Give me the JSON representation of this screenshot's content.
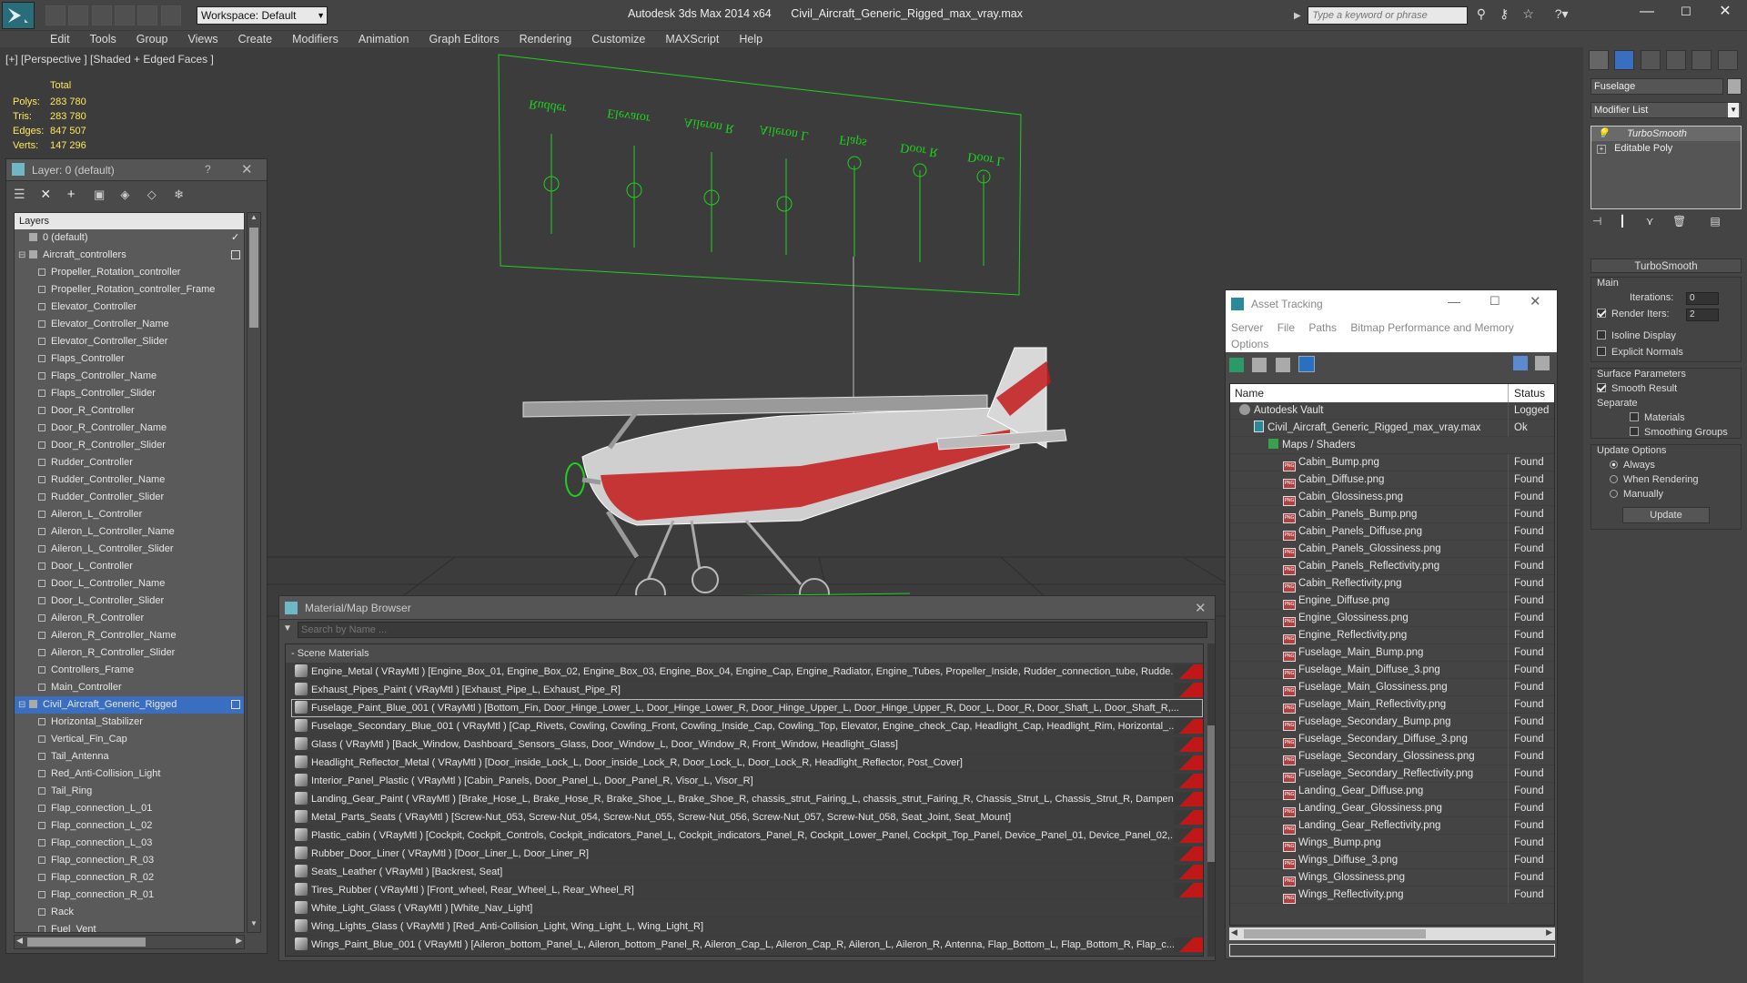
{
  "titlebar": {
    "workspace": "Workspace: Default",
    "title": "Autodesk 3ds Max  2014 x64",
    "filename": "Civil_Aircraft_Generic_Rigged_max_vray.max",
    "search_placeholder": "Type a keyword or phrase"
  },
  "menu": [
    "Edit",
    "Tools",
    "Group",
    "Views",
    "Create",
    "Modifiers",
    "Animation",
    "Graph Editors",
    "Rendering",
    "Customize",
    "MAXScript",
    "Help"
  ],
  "viewport": {
    "label": "[+] [Perspective ] [Shaded + Edged Faces ]",
    "stats": {
      "header": "Total",
      "rows": [
        {
          "k": "Polys:",
          "v": "283 780"
        },
        {
          "k": "Tris:",
          "v": "283 780"
        },
        {
          "k": "Edges:",
          "v": "847 507"
        },
        {
          "k": "Verts:",
          "v": "147 296"
        }
      ]
    },
    "control_labels": [
      "Rudder",
      "Elevator",
      "Aileron R",
      "Aileron L",
      "Flaps",
      "Door R",
      "Door L"
    ],
    "colors": {
      "wire": "#1fd01f",
      "red": "#c41a1a"
    }
  },
  "layer_panel": {
    "title": "Layer: 0 (default)",
    "help": "?",
    "header": "Layers",
    "rows": [
      {
        "label": "0 (default)",
        "kind": "layer",
        "indent": 0,
        "sel": false
      },
      {
        "label": "Aircraft_controllers",
        "kind": "layer",
        "indent": 0,
        "sel": false
      },
      {
        "label": "Propeller_Rotation_controller",
        "kind": "obj",
        "indent": 1,
        "sel": false
      },
      {
        "label": "Propeller_Rotation_controller_Frame",
        "kind": "obj",
        "indent": 1,
        "sel": false
      },
      {
        "label": "Elevator_Controller",
        "kind": "obj",
        "indent": 1,
        "sel": false
      },
      {
        "label": "Elevator_Controller_Name",
        "kind": "obj",
        "indent": 1,
        "sel": false
      },
      {
        "label": "Elevator_Controller_Slider",
        "kind": "obj",
        "indent": 1,
        "sel": false
      },
      {
        "label": "Flaps_Controller",
        "kind": "obj",
        "indent": 1,
        "sel": false
      },
      {
        "label": "Flaps_Controller_Name",
        "kind": "obj",
        "indent": 1,
        "sel": false
      },
      {
        "label": "Flaps_Controller_Slider",
        "kind": "obj",
        "indent": 1,
        "sel": false
      },
      {
        "label": "Door_R_Controller",
        "kind": "obj",
        "indent": 1,
        "sel": false
      },
      {
        "label": "Door_R_Controller_Name",
        "kind": "obj",
        "indent": 1,
        "sel": false
      },
      {
        "label": "Door_R_Controller_Slider",
        "kind": "obj",
        "indent": 1,
        "sel": false
      },
      {
        "label": "Rudder_Controller",
        "kind": "obj",
        "indent": 1,
        "sel": false
      },
      {
        "label": "Rudder_Controller_Name",
        "kind": "obj",
        "indent": 1,
        "sel": false
      },
      {
        "label": "Rudder_Controller_Slider",
        "kind": "obj",
        "indent": 1,
        "sel": false
      },
      {
        "label": "Aileron_L_Controller",
        "kind": "obj",
        "indent": 1,
        "sel": false
      },
      {
        "label": "Aileron_L_Controller_Name",
        "kind": "obj",
        "indent": 1,
        "sel": false
      },
      {
        "label": "Aileron_L_Controller_Slider",
        "kind": "obj",
        "indent": 1,
        "sel": false
      },
      {
        "label": "Door_L_Controller",
        "kind": "obj",
        "indent": 1,
        "sel": false
      },
      {
        "label": "Door_L_Controller_Name",
        "kind": "obj",
        "indent": 1,
        "sel": false
      },
      {
        "label": "Door_L_Controller_Slider",
        "kind": "obj",
        "indent": 1,
        "sel": false
      },
      {
        "label": "Aileron_R_Controller",
        "kind": "obj",
        "indent": 1,
        "sel": false
      },
      {
        "label": "Aileron_R_Controller_Name",
        "kind": "obj",
        "indent": 1,
        "sel": false
      },
      {
        "label": "Aileron_R_Controller_Slider",
        "kind": "obj",
        "indent": 1,
        "sel": false
      },
      {
        "label": "Controllers_Frame",
        "kind": "obj",
        "indent": 1,
        "sel": false
      },
      {
        "label": "Main_Controller",
        "kind": "obj",
        "indent": 1,
        "sel": false
      },
      {
        "label": "Civil_Aircraft_Generic_Rigged",
        "kind": "layer",
        "indent": 0,
        "sel": true
      },
      {
        "label": "Horizontal_Stabilizer",
        "kind": "obj",
        "indent": 1,
        "sel": false
      },
      {
        "label": "Vertical_Fin_Cap",
        "kind": "obj",
        "indent": 1,
        "sel": false
      },
      {
        "label": "Tail_Antenna",
        "kind": "obj",
        "indent": 1,
        "sel": false
      },
      {
        "label": "Red_Anti-Collision_Light",
        "kind": "obj",
        "indent": 1,
        "sel": false
      },
      {
        "label": "Tail_Ring",
        "kind": "obj",
        "indent": 1,
        "sel": false
      },
      {
        "label": "Flap_connection_L_01",
        "kind": "obj",
        "indent": 1,
        "sel": false
      },
      {
        "label": "Flap_connection_L_02",
        "kind": "obj",
        "indent": 1,
        "sel": false
      },
      {
        "label": "Flap_connection_L_03",
        "kind": "obj",
        "indent": 1,
        "sel": false
      },
      {
        "label": "Flap_connection_R_03",
        "kind": "obj",
        "indent": 1,
        "sel": false
      },
      {
        "label": "Flap_connection_R_02",
        "kind": "obj",
        "indent": 1,
        "sel": false
      },
      {
        "label": "Flap_connection_R_01",
        "kind": "obj",
        "indent": 1,
        "sel": false
      },
      {
        "label": "Rack",
        "kind": "obj",
        "indent": 1,
        "sel": false
      },
      {
        "label": "Fuel_Vent",
        "kind": "obj",
        "indent": 1,
        "sel": false
      }
    ]
  },
  "material_browser": {
    "title": "Material/Map Browser",
    "search_placeholder": "Search by Name ...",
    "group": "- Scene Materials",
    "rows": [
      {
        "text": "Engine_Metal  ( VRayMtl ) [Engine_Box_01, Engine_Box_02, Engine_Box_03, Engine_Box_04, Engine_Cap, Engine_Radiator, Engine_Tubes, Propeller_Inside, Rudder_connection_tube, Rudde...",
        "red": true,
        "sel": false
      },
      {
        "text": "Exhaust_Pipes_Paint  ( VRayMtl ) [Exhaust_Pipe_L, Exhaust_Pipe_R]",
        "red": true,
        "sel": false
      },
      {
        "text": "Fuselage_Paint_Blue_001 ( VRayMtl ) [Bottom_Fin, Door_Hinge_Lower_L, Door_Hinge_Lower_R, Door_Hinge_Upper_L, Door_Hinge_Upper_R, Door_L, Door_R, Door_Shaft_L, Door_Shaft_R,...",
        "red": false,
        "sel": true
      },
      {
        "text": "Fuselage_Secondary_Blue_001 ( VRayMtl ) [Cap_Rivets, Cowling, Cowling_Front, Cowling_Inside_Cap, Cowling_Top, Elevator, Engine_check_Cap, Headlight_Cap, Headlight_Rim, Horizontal_...",
        "red": true,
        "sel": false
      },
      {
        "text": "Glass ( VRayMtl ) [Back_Window, Dashboard_Sensors_Glass, Door_Window_L, Door_Window_R, Front_Window, Headlight_Glass]",
        "red": true,
        "sel": false
      },
      {
        "text": "Headlight_Reflector_Metal ( VRayMtl ) [Door_inside_Lock_L, Door_inside_Lock_R, Door_Lock_L, Door_Lock_R, Headlight_Reflector, Post_Cover]",
        "red": true,
        "sel": false
      },
      {
        "text": "Interior_Panel_Plastic  ( VRayMtl ) [Cabin_Panels, Door_Panel_L, Door_Panel_R, Visor_L, Visor_R]",
        "red": true,
        "sel": false
      },
      {
        "text": "Landing_Gear_Paint ( VRayMtl ) [Brake_Hose_L, Brake_Hose_R, Brake_Shoe_L, Brake_Shoe_R, chassis_strut_Fairing_L, chassis_strut_Fairing_R, Chassis_Strut_L, Chassis_Strut_R, Dampene...",
        "red": true,
        "sel": false
      },
      {
        "text": "Metal_Parts_Seats  ( VRayMtl ) [Screw-Nut_053, Screw-Nut_054, Screw-Nut_055, Screw-Nut_056, Screw-Nut_057, Screw-Nut_058, Seat_Joint, Seat_Mount]",
        "red": true,
        "sel": false
      },
      {
        "text": "Plastic_cabin ( VRayMtl ) [Cockpit, Cockpit_Controls, Cockpit_indicators_Panel_L, Cockpit_indicators_Panel_R, Cockpit_Lower_Panel, Cockpit_Top_Panel, Device_Panel_01, Device_Panel_02,...",
        "red": true,
        "sel": false
      },
      {
        "text": "Rubber_Door_Liner  ( VRayMtl ) [Door_Liner_L, Door_Liner_R]",
        "red": true,
        "sel": false
      },
      {
        "text": "Seats_Leather  ( VRayMtl ) [Backrest, Seat]",
        "red": true,
        "sel": false
      },
      {
        "text": "Tires_Rubber  ( VRayMtl ) [Front_wheel, Rear_Wheel_L, Rear_Wheel_R]",
        "red": true,
        "sel": false
      },
      {
        "text": "White_Light_Glass  ( VRayMtl ) [White_Nav_Light]",
        "red": false,
        "sel": false
      },
      {
        "text": "Wing_Lights_Glass ( VRayMtl ) [Red_Anti-Collision_Light, Wing_Light_L, Wing_Light_R]",
        "red": false,
        "sel": false
      },
      {
        "text": "Wings_Paint_Blue_001  ( VRayMtl ) [Aileron_bottom_Panel_L, Aileron_bottom_Panel_R, Aileron_Cap_L, Aileron_Cap_R, Aileron_L, Aileron_R, Antenna, Flap_Bottom_L, Flap_Bottom_R, Flap_c...",
        "red": true,
        "sel": false
      }
    ]
  },
  "asset_tracking": {
    "title": "Asset Tracking",
    "menu": [
      "Server",
      "File",
      "Paths",
      "Bitmap Performance and Memory"
    ],
    "menu2": "Options",
    "col_name": "Name",
    "col_status": "Status",
    "rows": [
      {
        "name": "Autodesk Vault",
        "status": "Logged",
        "indent": 1,
        "kind": "vault"
      },
      {
        "name": "Civil_Aircraft_Generic_Rigged_max_vray.max",
        "status": "Ok",
        "indent": 2,
        "kind": "max"
      },
      {
        "name": "Maps / Shaders",
        "status": "",
        "indent": 3,
        "kind": "folder"
      },
      {
        "name": "Cabin_Bump.png",
        "status": "Found",
        "indent": 4,
        "kind": "png"
      },
      {
        "name": "Cabin_Diffuse.png",
        "status": "Found",
        "indent": 4,
        "kind": "png"
      },
      {
        "name": "Cabin_Glossiness.png",
        "status": "Found",
        "indent": 4,
        "kind": "png"
      },
      {
        "name": "Cabin_Panels_Bump.png",
        "status": "Found",
        "indent": 4,
        "kind": "png"
      },
      {
        "name": "Cabin_Panels_Diffuse.png",
        "status": "Found",
        "indent": 4,
        "kind": "png"
      },
      {
        "name": "Cabin_Panels_Glossiness.png",
        "status": "Found",
        "indent": 4,
        "kind": "png"
      },
      {
        "name": "Cabin_Panels_Reflectivity.png",
        "status": "Found",
        "indent": 4,
        "kind": "png"
      },
      {
        "name": "Cabin_Reflectivity.png",
        "status": "Found",
        "indent": 4,
        "kind": "png"
      },
      {
        "name": "Engine_Diffuse.png",
        "status": "Found",
        "indent": 4,
        "kind": "png"
      },
      {
        "name": "Engine_Glossiness.png",
        "status": "Found",
        "indent": 4,
        "kind": "png"
      },
      {
        "name": "Engine_Reflectivity.png",
        "status": "Found",
        "indent": 4,
        "kind": "png"
      },
      {
        "name": "Fuselage_Main_Bump.png",
        "status": "Found",
        "indent": 4,
        "kind": "png"
      },
      {
        "name": "Fuselage_Main_Diffuse_3.png",
        "status": "Found",
        "indent": 4,
        "kind": "png"
      },
      {
        "name": "Fuselage_Main_Glossiness.png",
        "status": "Found",
        "indent": 4,
        "kind": "png"
      },
      {
        "name": "Fuselage_Main_Reflectivity.png",
        "status": "Found",
        "indent": 4,
        "kind": "png"
      },
      {
        "name": "Fuselage_Secondary_Bump.png",
        "status": "Found",
        "indent": 4,
        "kind": "png"
      },
      {
        "name": "Fuselage_Secondary_Diffuse_3.png",
        "status": "Found",
        "indent": 4,
        "kind": "png"
      },
      {
        "name": "Fuselage_Secondary_Glossiness.png",
        "status": "Found",
        "indent": 4,
        "kind": "png"
      },
      {
        "name": "Fuselage_Secondary_Reflectivity.png",
        "status": "Found",
        "indent": 4,
        "kind": "png"
      },
      {
        "name": "Landing_Gear_Diffuse.png",
        "status": "Found",
        "indent": 4,
        "kind": "png"
      },
      {
        "name": "Landing_Gear_Glossiness.png",
        "status": "Found",
        "indent": 4,
        "kind": "png"
      },
      {
        "name": "Landing_Gear_Reflectivity.png",
        "status": "Found",
        "indent": 4,
        "kind": "png"
      },
      {
        "name": "Wings_Bump.png",
        "status": "Found",
        "indent": 4,
        "kind": "png"
      },
      {
        "name": "Wings_Diffuse_3.png",
        "status": "Found",
        "indent": 4,
        "kind": "png"
      },
      {
        "name": "Wings_Glossiness.png",
        "status": "Found",
        "indent": 4,
        "kind": "png"
      },
      {
        "name": "Wings_Reflectivity.png",
        "status": "Found",
        "indent": 4,
        "kind": "png"
      }
    ]
  },
  "command_panel": {
    "object_name": "Fuselage",
    "modifier_list": "Modifier List",
    "stack": [
      "TurboSmooth",
      "Editable Poly"
    ],
    "rollout_title": "TurboSmooth",
    "main_label": "Main",
    "iterations_label": "Iterations:",
    "iterations": "0",
    "render_iters_label": "Render Iters:",
    "render_iters": "2",
    "isoline": "Isoline Display",
    "explicit": "Explicit Normals",
    "surface_params": "Surface Parameters",
    "smooth_result": "Smooth Result",
    "separate": "Separate",
    "materials": "Materials",
    "smoothing_groups": "Smoothing Groups",
    "update_options": "Update Options",
    "always": "Always",
    "when_rendering": "When Rendering",
    "manually": "Manually",
    "update_button": "Update"
  }
}
